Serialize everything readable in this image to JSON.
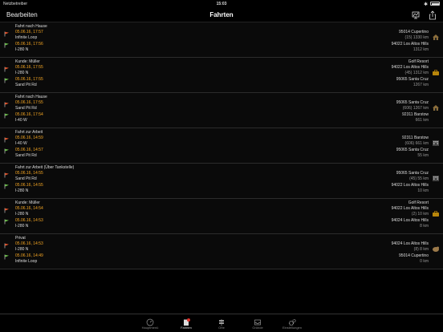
{
  "status_bar": {
    "carrier": "Netzbetreiber",
    "time": "15:03"
  },
  "nav": {
    "edit": "Bearbeiten",
    "title": "Fahrten"
  },
  "trips": [
    {
      "purpose": "Fahrt nach Hause",
      "start_time": "05.06.16, 17:57",
      "start_road": "Infinite Loop",
      "end_time": "05.06.16, 17:56",
      "end_road": "I-280 N",
      "start_addr": "95014 Cupertino",
      "stat": "(15) 1330 km",
      "end_addr": "94022 Los Altos Hills",
      "odo": "1312 km",
      "category": "home"
    },
    {
      "purpose": "Kunde: Müller",
      "start_time": "05.06.16, 17:55",
      "start_road": "I-280 N",
      "end_time": "05.06.16, 17:55",
      "end_road": "Sand Pit Rd",
      "start_addr": "Golf Resort\n94022 Los Altos Hills",
      "stat": "(45) 1312 km",
      "end_addr": "95065 Santa Cruz",
      "odo": "1267 km",
      "category": "business"
    },
    {
      "purpose": "Fahrt nach Hause",
      "start_time": "05.06.16, 17:55",
      "start_road": "Sand Pit Rd",
      "end_time": "05.06.16, 17:54",
      "end_road": "I-40 W",
      "start_addr": "95065 Santa Cruz",
      "stat": "(606) 1267 km",
      "end_addr": "92311 Barstow",
      "odo": "661 km",
      "category": "home"
    },
    {
      "purpose": "Fahrt zur Arbeit",
      "start_time": "05.06.16, 14:59",
      "start_road": "I-40 W",
      "end_time": "05.06.16, 14:57",
      "end_road": "Sand Pit Rd",
      "start_addr": "92311 Barstow",
      "stat": "(606) 661 km",
      "end_addr": "95065 Santa Cruz",
      "odo": "55 km",
      "category": "work"
    },
    {
      "purpose": "Fahrt zur Arbeit (Über Tankstelle)",
      "start_time": "05.06.16, 14:55",
      "start_road": "Sand Pit Rd",
      "end_time": "05.06.16, 14:55",
      "end_road": "I-280 N",
      "start_addr": "95065 Santa Cruz",
      "stat": "(45) 55 km",
      "end_addr": "94022 Los Altos Hills",
      "odo": "10 km",
      "category": "work"
    },
    {
      "purpose": "Kunde: Müller",
      "start_time": "05.06.16, 14:54",
      "start_road": "I-280 N",
      "end_time": "05.06.16, 14:53",
      "end_road": "I-280 N",
      "start_addr": "Golf Resort\n94022 Los Altos Hills",
      "stat": "(2) 10 km",
      "end_addr": "94024 Los Altos Hills",
      "odo": "8 km",
      "category": "business"
    },
    {
      "purpose": "Privat",
      "start_time": "05.06.16, 14:53",
      "start_road": "I-280 N",
      "end_time": "05.06.16, 14:49",
      "end_road": "Infinite Loop",
      "start_addr": "94024 Los Altos Hills",
      "stat": "(8) 8 km",
      "end_addr": "95014 Cupertino",
      "odo": "0 km",
      "category": "private"
    }
  ],
  "tabbar": {
    "tabs": [
      {
        "label": "Hauptmenü",
        "icon": "dashboard-icon"
      },
      {
        "label": "Fahrten",
        "icon": "trips-icon",
        "badge": true
      },
      {
        "label": "Orte",
        "icon": "signpost-icon"
      },
      {
        "label": "Gründe",
        "icon": "inbox-icon"
      },
      {
        "label": "Einstellungen",
        "icon": "gears-icon"
      }
    ]
  },
  "colors": {
    "accent": "#f5a623",
    "start_flag": "#e8542a",
    "end_flag": "#6cc24a",
    "badge": "#e0302a"
  }
}
